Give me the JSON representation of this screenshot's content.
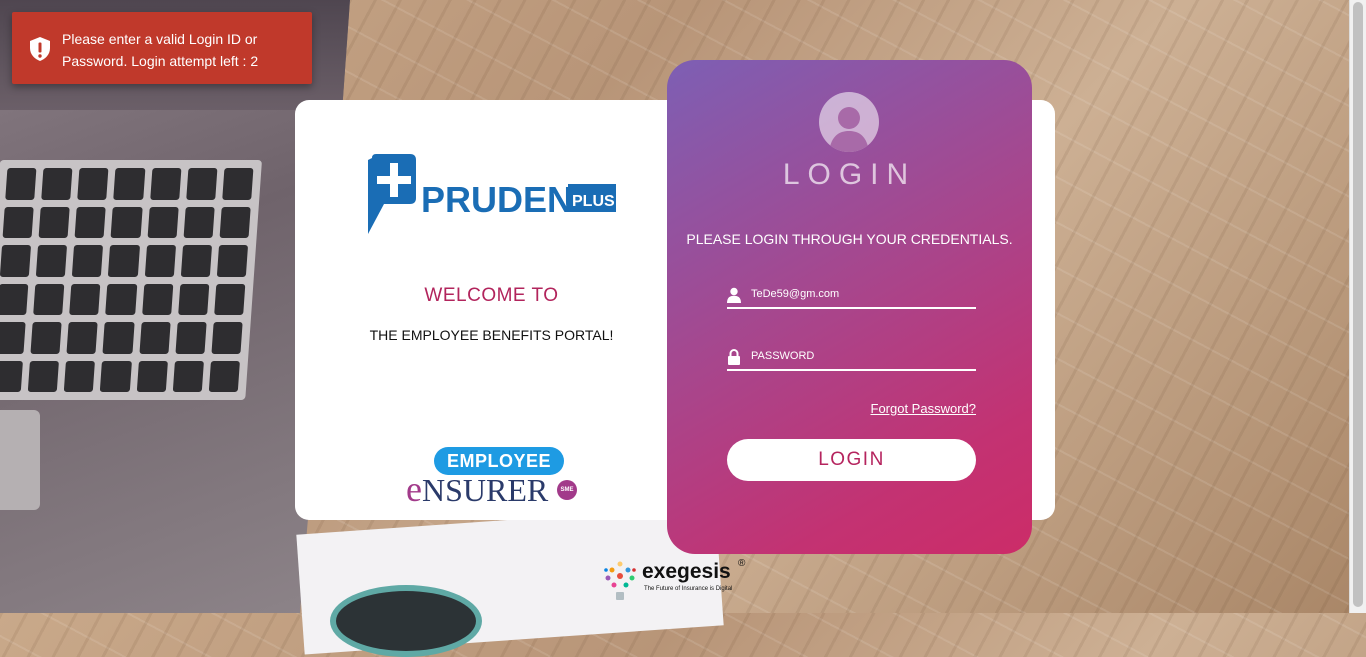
{
  "alert": {
    "icon": "shield-exclamation-icon",
    "message": "Please enter a valid Login ID or Password. Login attempt left : 2",
    "color": "#c0392b"
  },
  "brand": {
    "logo_word": "PRUDENT",
    "logo_badge": "PLUS",
    "logo_color": "#1a6db5"
  },
  "welcome": {
    "heading": "WELCOME TO",
    "subheading": "THE EMPLOYEE BENEFITS PORTAL!"
  },
  "product": {
    "badge": "EMPLOYEE",
    "word_first": "e",
    "word_rest": "NSURER",
    "sme": "SME"
  },
  "login": {
    "avatar_icon": "user-avatar-icon",
    "title": "LOGIN",
    "subtitle": "PLEASE LOGIN THROUGH YOUR CREDENTIALS.",
    "username": {
      "icon": "user-icon",
      "value": "TeDe59@gm.com"
    },
    "password": {
      "icon": "lock-icon",
      "placeholder": "PASSWORD",
      "value": ""
    },
    "forgot_link": "Forgot Password?",
    "button": "LOGIN",
    "gradient": [
      "#7d5fb4",
      "#cc2c68"
    ]
  },
  "footer": {
    "logo_name": "exegesis",
    "logo_mark": "®",
    "tagline": "The Future of Insurance is Digital"
  }
}
